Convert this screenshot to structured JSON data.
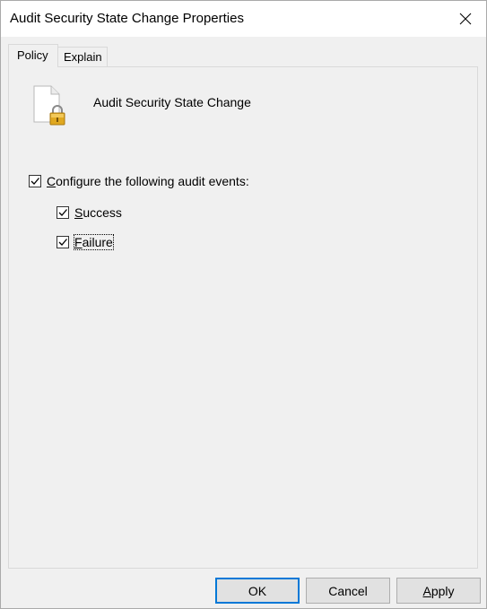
{
  "window": {
    "title": "Audit Security State Change Properties"
  },
  "tabs": [
    {
      "label": "Policy",
      "active": true
    },
    {
      "label": "Explain",
      "active": false
    }
  ],
  "policy": {
    "name": "Audit Security State Change",
    "icon": "locked-document-icon"
  },
  "configure": {
    "label_first": "C",
    "label_rest": "onfigure the following audit events:",
    "checked": true
  },
  "success": {
    "label_first": "S",
    "label_rest": "uccess",
    "checked": true
  },
  "failure": {
    "label_first": "F",
    "label_rest": "ailure",
    "checked": true
  },
  "buttons": {
    "ok": "OK",
    "cancel": "Cancel",
    "apply_first": "A",
    "apply_rest": "pply"
  },
  "colors": {
    "accent": "#0078d7",
    "background": "#f0f0f0",
    "titlebar": "#ffffff"
  }
}
